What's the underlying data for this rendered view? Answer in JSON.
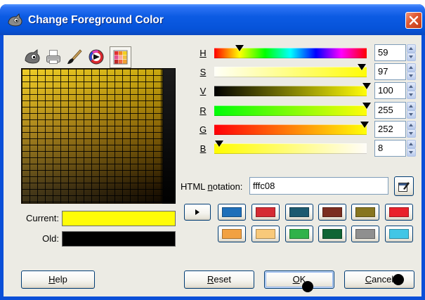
{
  "window": {
    "title": "Change Foreground Color",
    "title_icon": "gimp-wilber-icon",
    "close_icon": "close-icon"
  },
  "selector_tabs": [
    {
      "icon": "wilber-icon",
      "selected": false
    },
    {
      "icon": "printer-icon",
      "selected": false
    },
    {
      "icon": "brush-icon",
      "selected": false
    },
    {
      "icon": "color-wheel-icon",
      "selected": false
    },
    {
      "icon": "palette-icon",
      "selected": true
    }
  ],
  "current": {
    "label": "Current:",
    "color": "#fffc08"
  },
  "old": {
    "label": "Old:",
    "color": "#000000"
  },
  "sliders": [
    {
      "label": "H",
      "value": 59,
      "gradient": [
        "#ff0000",
        "#ffff00",
        "#00ff00",
        "#00ffff",
        "#0000ff",
        "#ff00ff",
        "#ff0000"
      ]
    },
    {
      "label": "S",
      "value": 97,
      "gradient": [
        "#fffff8",
        "#fffc08"
      ]
    },
    {
      "label": "V",
      "value": 100,
      "gradient": [
        "#000000",
        "#fffc08"
      ]
    },
    {
      "label": "R",
      "value": 255,
      "gradient": [
        "#00fc08",
        "#fffc08"
      ]
    },
    {
      "label": "G",
      "value": 252,
      "gradient": [
        "#ff0008",
        "#ffff08"
      ]
    },
    {
      "label": "B",
      "value": 8,
      "gradient": [
        "#fffc00",
        "#fffcf8"
      ]
    }
  ],
  "html_notation": {
    "label": "HTML notation:",
    "value": "fffc08",
    "picker_icon": "color-picker-icon"
  },
  "history": {
    "add_icon": "arrow-right-icon",
    "swatches": [
      "#1f6fb9",
      "#d52b33",
      "#1d5a70",
      "#7b2d20",
      "#87751f",
      "#e9212b",
      "#f1a142",
      "#f8c97a",
      "#2fb24a",
      "#0f6535",
      "#8f8f8f",
      "#41c6e6"
    ]
  },
  "buttons": {
    "help": "Help",
    "reset": "Reset",
    "ok": "OK",
    "cancel": "Cancel"
  }
}
